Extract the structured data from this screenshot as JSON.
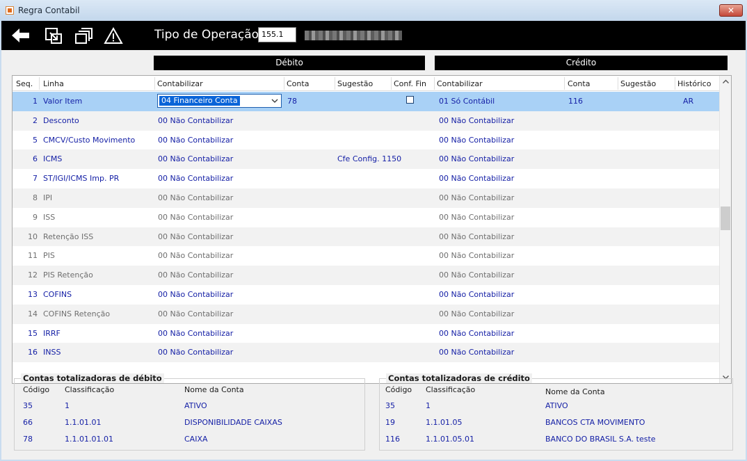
{
  "window": {
    "title": "Regra Contabil",
    "close_label": "✕"
  },
  "toolbar": {
    "operation_label": "Tipo de Operação",
    "operation_code": "155.1"
  },
  "sections": {
    "debit": "Débito",
    "credit": "Crédito"
  },
  "grid": {
    "columns": {
      "seq": "Seq.",
      "linha": "Linha",
      "contabilizar_debito": "Contabilizar",
      "conta_debito": "Conta",
      "sugestao_debito": "Sugestão",
      "conf_fin": "Conf. Fin",
      "contabilizar_credito": "Contabilizar",
      "conta_credito": "Conta",
      "sugestao_credito": "Sugestão",
      "historico": "Histórico"
    },
    "rows": [
      {
        "seq": "1",
        "linha": "Valor Item",
        "deb": "04 Financeiro Conta",
        "deb_conta": "78",
        "deb_sug": "",
        "cred": "01 Só Contábil",
        "cred_conta": "116",
        "hist": "AR"
      },
      {
        "seq": "2",
        "linha": "Desconto",
        "deb": "00 Não Contabilizar",
        "deb_conta": "",
        "deb_sug": "",
        "cred": "00 Não Contabilizar",
        "cred_conta": "",
        "hist": ""
      },
      {
        "seq": "5",
        "linha": "CMCV/Custo Movimento",
        "deb": "00 Não Contabilizar",
        "deb_conta": "",
        "deb_sug": "",
        "cred": "00 Não Contabilizar",
        "cred_conta": "",
        "hist": ""
      },
      {
        "seq": "6",
        "linha": "ICMS",
        "deb": "00 Não Contabilizar",
        "deb_conta": "",
        "deb_sug": "Cfe Config. 1150",
        "cred": "00 Não Contabilizar",
        "cred_conta": "",
        "hist": ""
      },
      {
        "seq": "7",
        "linha": "ST/IGI/ICMS Imp. PR",
        "deb": "00 Não Contabilizar",
        "deb_conta": "",
        "deb_sug": "",
        "cred": "00 Não Contabilizar",
        "cred_conta": "",
        "hist": ""
      },
      {
        "seq": "8",
        "linha": "IPI",
        "deb": "00 Não Contabilizar",
        "deb_conta": "",
        "deb_sug": "",
        "cred": "00 Não Contabilizar",
        "cred_conta": "",
        "hist": ""
      },
      {
        "seq": "9",
        "linha": "ISS",
        "deb": "00 Não Contabilizar",
        "deb_conta": "",
        "deb_sug": "",
        "cred": "00 Não Contabilizar",
        "cred_conta": "",
        "hist": ""
      },
      {
        "seq": "10",
        "linha": "Retenção ISS",
        "deb": "00 Não Contabilizar",
        "deb_conta": "",
        "deb_sug": "",
        "cred": "00 Não Contabilizar",
        "cred_conta": "",
        "hist": ""
      },
      {
        "seq": "11",
        "linha": "PIS",
        "deb": "00 Não Contabilizar",
        "deb_conta": "",
        "deb_sug": "",
        "cred": "00 Não Contabilizar",
        "cred_conta": "",
        "hist": ""
      },
      {
        "seq": "12",
        "linha": "PIS Retenção",
        "deb": "00 Não Contabilizar",
        "deb_conta": "",
        "deb_sug": "",
        "cred": "00 Não Contabilizar",
        "cred_conta": "",
        "hist": ""
      },
      {
        "seq": "13",
        "linha": "COFINS",
        "deb": "00 Não Contabilizar",
        "deb_conta": "",
        "deb_sug": "",
        "cred": "00 Não Contabilizar",
        "cred_conta": "",
        "hist": ""
      },
      {
        "seq": "14",
        "linha": "COFINS Retenção",
        "deb": "00 Não Contabilizar",
        "deb_conta": "",
        "deb_sug": "",
        "cred": "00 Não Contabilizar",
        "cred_conta": "",
        "hist": ""
      },
      {
        "seq": "15",
        "linha": "IRRF",
        "deb": "00 Não Contabilizar",
        "deb_conta": "",
        "deb_sug": "",
        "cred": "00 Não Contabilizar",
        "cred_conta": "",
        "hist": ""
      },
      {
        "seq": "16",
        "linha": "INSS",
        "deb": "00 Não Contabilizar",
        "deb_conta": "",
        "deb_sug": "",
        "cred": "00 Não Contabilizar",
        "cred_conta": "",
        "hist": ""
      }
    ]
  },
  "debit_totals": {
    "title": "Contas totalizadoras de débito",
    "columns": {
      "codigo": "Código",
      "classificacao": "Classificação",
      "nome": "Nome da Conta"
    },
    "rows": [
      {
        "codigo": "35",
        "classificacao": "1",
        "nome": "ATIVO"
      },
      {
        "codigo": "66",
        "classificacao": "1.1.01.01",
        "nome": "DISPONIBILIDADE CAIXAS"
      },
      {
        "codigo": "78",
        "classificacao": "1.1.01.01.01",
        "nome": "CAIXA"
      }
    ]
  },
  "credit_totals": {
    "title": "Contas totalizadoras de crédito",
    "columns": {
      "codigo": "Código",
      "classificacao": "Classificação",
      "nome": "Nome da Conta"
    },
    "rows": [
      {
        "codigo": "35",
        "classificacao": "1",
        "nome": "ATIVO"
      },
      {
        "codigo": "19",
        "classificacao": "1.1.01.05",
        "nome": "BANCOS CTA MOVIMENTO"
      },
      {
        "codigo": "116",
        "classificacao": "1.1.01.05.01",
        "nome": "BANCO DO BRASIL S.A. teste"
      }
    ]
  },
  "colors": {
    "link_blue": "#1520a6",
    "inactive_gray": "#6f6f6f",
    "selection": "#a9d1f6",
    "toolbar": "#000000"
  },
  "icons": [
    "back-arrow-icon",
    "export-icon",
    "copy-icon",
    "warning-icon",
    "chevron-down-icon",
    "scroll-up-icon",
    "scroll-down-icon"
  ]
}
